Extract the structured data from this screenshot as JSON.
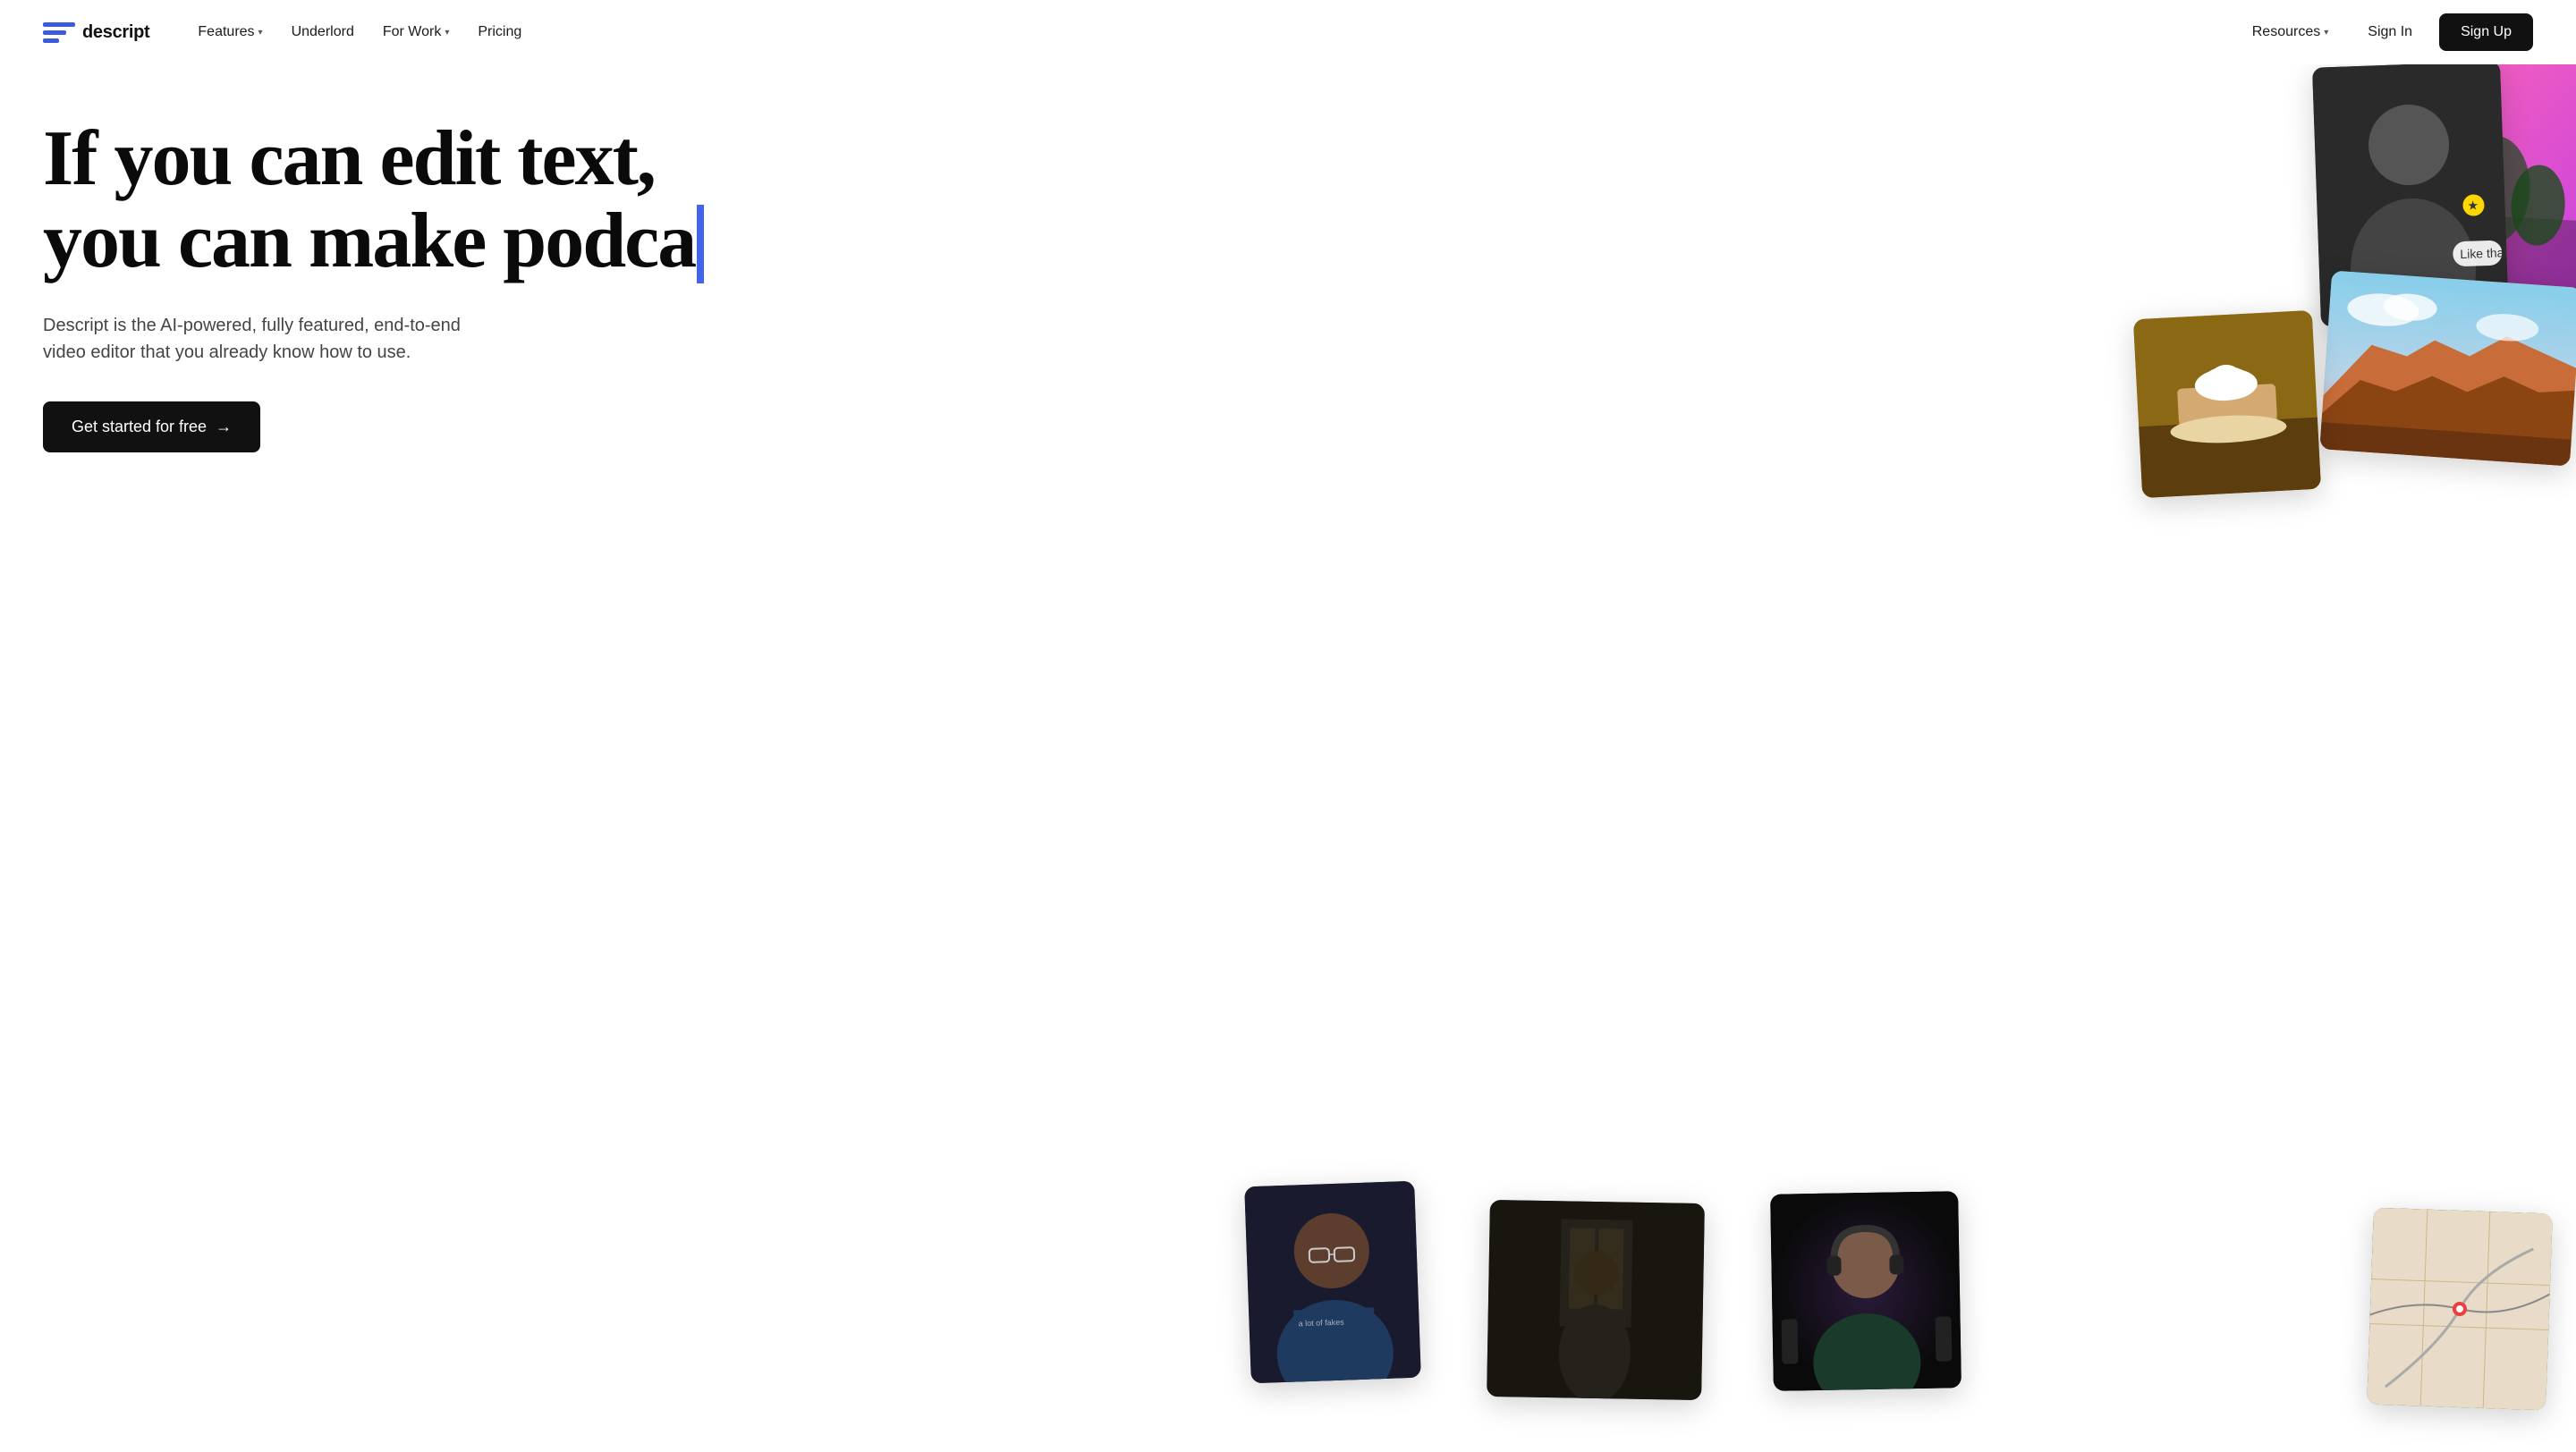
{
  "nav": {
    "logo_text": "descript",
    "items": [
      {
        "label": "Features",
        "has_dropdown": true
      },
      {
        "label": "Underlord",
        "has_dropdown": false
      },
      {
        "label": "For Work",
        "has_dropdown": true
      },
      {
        "label": "Pricing",
        "has_dropdown": false
      }
    ],
    "right_items": [
      {
        "label": "Resources",
        "has_dropdown": true
      },
      {
        "label": "Sign In",
        "has_dropdown": false
      }
    ],
    "signup_label": "Sign Up"
  },
  "hero": {
    "headline_line1": "If you can edit text,",
    "headline_line2": "you can make podca",
    "subtext": "Descript is the AI-powered, fully featured, end-to-end video editor that you already know how to use.",
    "cta_label": "Get started for free",
    "cta_arrow": "→"
  }
}
